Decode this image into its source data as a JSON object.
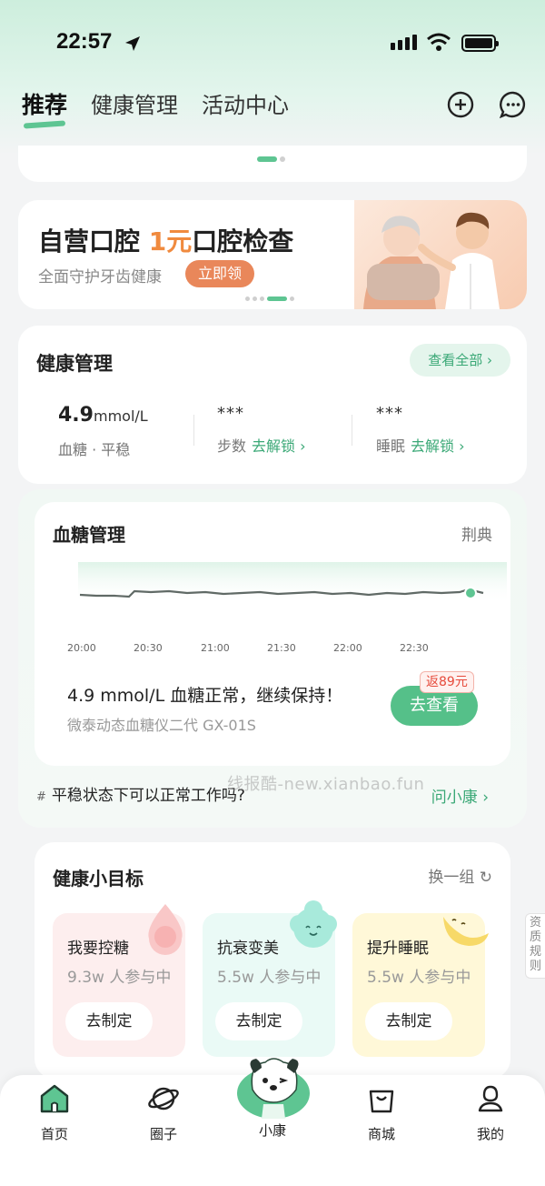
{
  "status_bar": {
    "time": "22:57"
  },
  "header": {
    "tabs": [
      {
        "label": "推荐",
        "active": true
      },
      {
        "label": "健康管理",
        "active": false
      },
      {
        "label": "活动中心",
        "active": false
      }
    ],
    "icons": [
      "add-circle-icon",
      "message-icon"
    ]
  },
  "banner": {
    "title_prefix": "自营口腔 ",
    "title_highlight": "1元",
    "title_suffix": "口腔检查",
    "subtitle": "全面守护牙齿健康",
    "cta": "立即领"
  },
  "health_mgmt": {
    "title": "健康管理",
    "view_all": "查看全部 ›",
    "metrics": [
      {
        "value": "4.9",
        "unit": "mmol/L",
        "label": "血糖 · 平稳",
        "action": ""
      },
      {
        "value": "***",
        "unit": "",
        "label": "步数",
        "action": "去解锁 ›"
      },
      {
        "value": "***",
        "unit": "",
        "label": "睡眠",
        "action": "去解锁 ›"
      }
    ]
  },
  "blood_sugar": {
    "title": "血糖管理",
    "right_label": "荆典",
    "time_ticks": [
      "20:00",
      "20:30",
      "21:00",
      "21:30",
      "22:00",
      "22:30"
    ],
    "status": "4.9 mmol/L 血糖正常，继续保持！",
    "device": "微泰动态血糖仪二代 GX-01S",
    "cta": "去查看",
    "rebate": "返89元",
    "question": "平稳状态下可以正常工作吗?",
    "question_hash": "#",
    "ask": "问小康 ›"
  },
  "goals": {
    "title": "健康小目标",
    "swap": "换一组 ↻",
    "items": [
      {
        "name": "我要控糖",
        "count": "9.3w 人参与中",
        "button": "去制定",
        "bg": "#fdeeee"
      },
      {
        "name": "抗衰变美",
        "count": "5.5w 人参与中",
        "button": "去制定",
        "bg": "#eafaf6"
      },
      {
        "name": "提升睡眠",
        "count": "5.5w 人参与中",
        "button": "去制定",
        "bg": "#fff8d8"
      }
    ]
  },
  "side_tag": "资质规则",
  "watermark": "线报酷-new.xianbao.fun",
  "bottom_nav": [
    {
      "label": "首页",
      "icon": "home-icon"
    },
    {
      "label": "圈子",
      "icon": "planet-icon"
    },
    {
      "label": "小康",
      "icon": "mascot-icon"
    },
    {
      "label": "商城",
      "icon": "shopping-bag-icon"
    },
    {
      "label": "我的",
      "icon": "profile-icon"
    }
  ],
  "colors": {
    "accent": "#5ec592",
    "accent_text": "#3aa876",
    "orange": "#f08a3e"
  }
}
